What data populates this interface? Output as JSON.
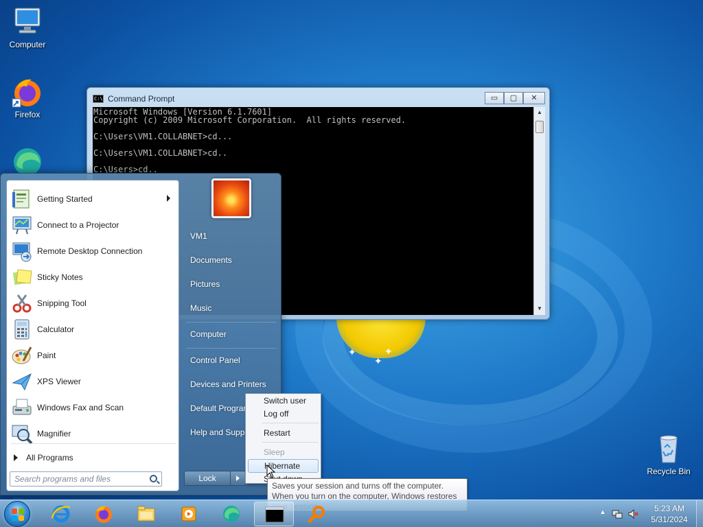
{
  "desktop": {
    "icons": [
      {
        "label": "Computer",
        "icon": "computer-icon"
      },
      {
        "label": "Firefox",
        "icon": "firefox-icon"
      },
      {
        "label": "",
        "icon": "edge-icon"
      },
      {
        "label": "Recycle Bin",
        "icon": "recycle-bin-icon"
      }
    ]
  },
  "cmd": {
    "title": "Command Prompt",
    "lines": [
      "Microsoft Windows [Version 6.1.7601]",
      "Copyright (c) 2009 Microsoft Corporation.  All rights reserved.",
      "",
      "C:\\Users\\VM1.COLLABNET>cd...",
      "",
      "C:\\Users\\VM1.COLLABNET>cd..",
      "",
      "C:\\Users>cd.."
    ],
    "buttons": {
      "minimize": "▭",
      "maximize": "▢",
      "close": "✕"
    }
  },
  "start_menu": {
    "programs": [
      {
        "label": "Getting Started",
        "icon": "getting-started-icon",
        "has_submenu": true
      },
      {
        "label": "Connect to a Projector",
        "icon": "projector-icon"
      },
      {
        "label": "Remote Desktop Connection",
        "icon": "remote-desktop-icon"
      },
      {
        "label": "Sticky Notes",
        "icon": "sticky-notes-icon"
      },
      {
        "label": "Snipping Tool",
        "icon": "snipping-tool-icon"
      },
      {
        "label": "Calculator",
        "icon": "calculator-icon"
      },
      {
        "label": "Paint",
        "icon": "paint-icon"
      },
      {
        "label": "XPS Viewer",
        "icon": "xps-viewer-icon"
      },
      {
        "label": "Windows Fax and Scan",
        "icon": "fax-scan-icon"
      },
      {
        "label": "Magnifier",
        "icon": "magnifier-icon"
      }
    ],
    "all_programs": "All Programs",
    "search_placeholder": "Search programs and files",
    "right_items": [
      "VM1",
      "Documents",
      "Pictures",
      "Music",
      "Computer",
      "Control Panel",
      "Devices and Printers",
      "Default Programs",
      "Help and Support"
    ],
    "lock_label": "Lock"
  },
  "power_menu": {
    "items": [
      {
        "label": "Switch user",
        "disabled": false
      },
      {
        "label": "Log off",
        "disabled": false
      },
      {
        "label": "Restart",
        "disabled": false
      },
      {
        "label": "Sleep",
        "disabled": true
      },
      {
        "label": "Hibernate",
        "disabled": false,
        "hover": true
      },
      {
        "label": "Shut down",
        "disabled": false
      }
    ]
  },
  "tooltip": {
    "text": "Saves your session and turns off the computer. When you turn on the computer, Windows restores your session."
  },
  "taskbar": {
    "pinned": [
      "ie-icon",
      "firefox-icon",
      "explorer-icon",
      "media-player-icon",
      "edge-icon",
      "cmd-icon",
      "search-tool-icon"
    ],
    "time": "5:23 AM",
    "date": "5/31/2024"
  },
  "colors": {
    "accent": "#1e78c8",
    "cmd_bg": "#000000",
    "cmd_text": "#c0c0c0",
    "tooltip_text": "#4c4c4c"
  }
}
